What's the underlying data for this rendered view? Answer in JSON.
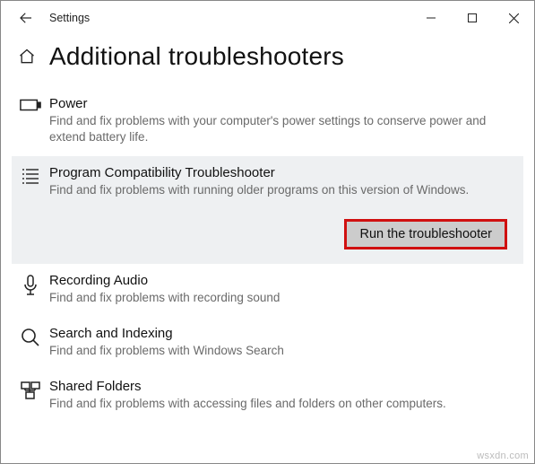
{
  "window": {
    "title": "Settings"
  },
  "header": {
    "title": "Additional troubleshooters"
  },
  "troubleshooters": [
    {
      "name": "Power",
      "desc": "Find and fix problems with your computer's power settings to conserve power and extend battery life."
    },
    {
      "name": "Program Compatibility Troubleshooter",
      "desc": "Find and fix problems with running older programs on this version of Windows."
    },
    {
      "name": "Recording Audio",
      "desc": "Find and fix problems with recording sound"
    },
    {
      "name": "Search and Indexing",
      "desc": "Find and fix problems with Windows Search"
    },
    {
      "name": "Shared Folders",
      "desc": "Find and fix problems with accessing files and folders on other computers."
    }
  ],
  "action": {
    "run_label": "Run the troubleshooter"
  },
  "watermark": "wsxdn.com"
}
